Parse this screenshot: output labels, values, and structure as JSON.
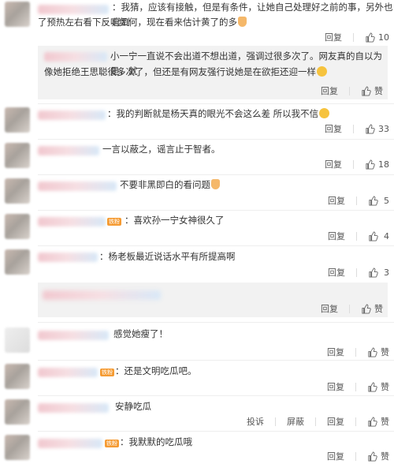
{
  "comments": [
    {
      "text1": "：我猜，应该有接触，但是有条件，让她自己处理好之前的事，另外也起到",
      "text2": "了预热左右看下反响如何，现在看来估计黄了的多",
      "reply": "回复",
      "like": "10",
      "emoji": "hand"
    },
    {
      "text1": "小一宁一直说不会出道不想出道，强调过很多次了。网友真的自以为是，就",
      "text2": "像她拒绝王思聪很多次了，但还是有网友强行说她是在欲拒还迎一样",
      "reply": "回复",
      "like": "赞",
      "emoji": "smile"
    },
    {
      "text1": "：我的判断就是杨天真的眼光不会这么差 所以我不信",
      "reply": "回复",
      "like": "33",
      "emoji": "smile"
    },
    {
      "text1": "一言以蔽之，谣言止于智者。",
      "reply": "回复",
      "like": "18"
    },
    {
      "text1": "不要非黑即白的看问题",
      "reply": "回复",
      "like": "5",
      "emoji": "hand"
    },
    {
      "text1": "：喜欢孙一宁女神很久了",
      "reply": "回复",
      "like": "4",
      "badge": "铁粉"
    },
    {
      "text1": "：杨老板最近说话水平有所提高啊",
      "reply": "回复",
      "like": "3"
    },
    {
      "reply": "回复",
      "like": "赞"
    },
    {
      "text1": "感觉她瘦了！",
      "reply": "回复",
      "like": "赞"
    },
    {
      "text1": "：还是文明吃瓜吧。",
      "reply": "回复",
      "like": "赞",
      "badge": "铁粉"
    },
    {
      "text1": "安静吃瓜",
      "report": "投诉",
      "block": "屏蔽",
      "reply": "回复",
      "like": "赞"
    },
    {
      "text1": "：我默默的吃瓜哦",
      "reply": "回复",
      "like": "赞",
      "badge": "铁粉"
    }
  ],
  "colors": {
    "badge": "#f59b33",
    "link": "#eb7350"
  }
}
